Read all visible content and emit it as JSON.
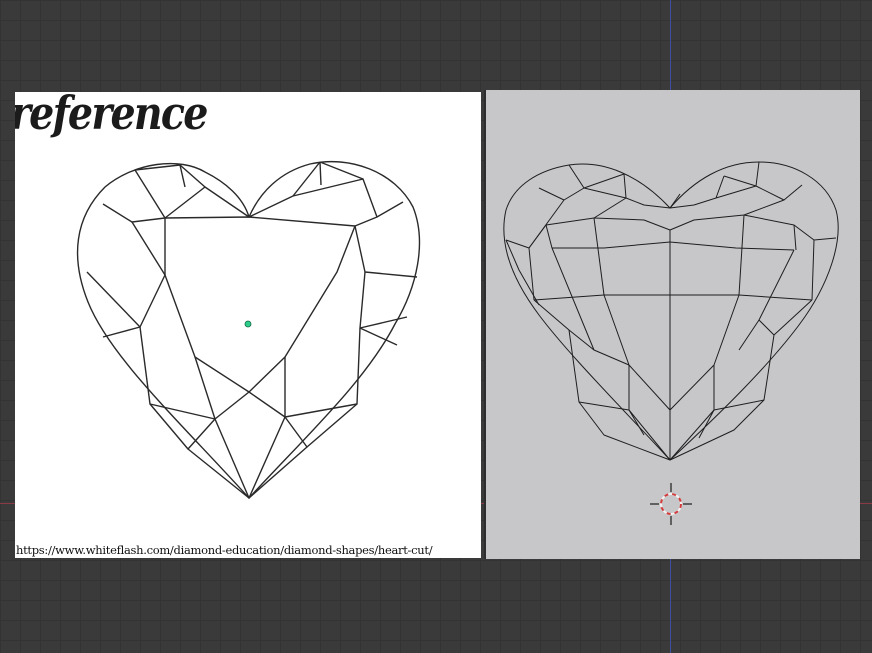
{
  "viewport": {
    "background_color": "#3a3a3a",
    "grid_color": "#333333",
    "x_axis_color": "#8a3a44",
    "y_axis_color": "#3c4fa0"
  },
  "reference_image": {
    "title": "reference",
    "source_url": "https://www.whiteflash.com/diamond-education/diamond-shapes/heart-cut/",
    "background_color": "#ffffff",
    "line_color": "#2a2a2a",
    "empty_marker_color": "#2ecc8a"
  },
  "mesh_view": {
    "background_color": "#c7c7ca",
    "edge_color": "#1e1e1e"
  },
  "cursor_3d": {
    "icon": "3d-cursor-icon",
    "ring_colors": [
      "#d23c3c",
      "#f2f2f2"
    ]
  }
}
